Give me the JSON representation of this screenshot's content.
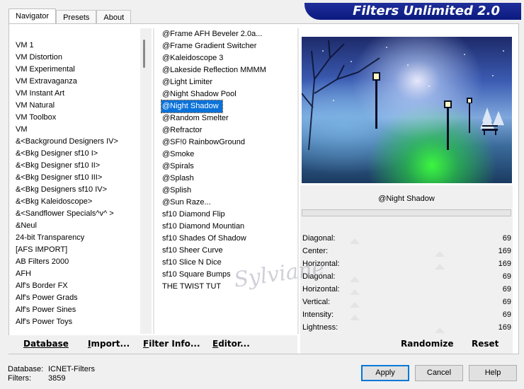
{
  "tabs": [
    {
      "label": "Navigator",
      "active": true
    },
    {
      "label": "Presets",
      "active": false
    },
    {
      "label": "About",
      "active": false
    }
  ],
  "app_title": "Filters Unlimited 2.0",
  "categories": [
    "VM 1",
    "VM Distortion",
    "VM Experimental",
    "VM Extravaganza",
    "VM Instant Art",
    "VM Natural",
    "VM Toolbox",
    "VM",
    "&<Background Designers IV>",
    "&<Bkg Designer sf10 I>",
    "&<Bkg Designer sf10 II>",
    "&<Bkg Designer sf10 III>",
    "&<Bkg Designers sf10 IV>",
    "&<Bkg Kaleidoscope>",
    "&<Sandflower Specials^v^ >",
    "&Neul",
    "24-bit Transparency",
    "[AFS IMPORT]",
    "AB Filters 2000",
    "AFH",
    "Alf's Border FX",
    "Alf's Power Grads",
    "Alf's Power Sines",
    "Alf's Power Toys"
  ],
  "filters": [
    "@Frame AFH Beveler 2.0a...",
    "@Frame Gradient Switcher",
    "@Kaleidoscope 3",
    "@Lakeside Reflection MMMM",
    "@Light Limiter",
    "@Night Shadow Pool",
    "@Night Shadow",
    "@Random Smelter",
    "@Refractor",
    "@SF!0 RainbowGround",
    "@Smoke",
    "@Spirals",
    "@Splash",
    "@Splish",
    "@Sun Raze...",
    "sf10 Diamond Flip",
    "sf10 Diamond Mountian",
    "sf10 Shades Of Shadow",
    "sf10 Sheer Curve",
    "sf10 Slice N Dice",
    "sf10 Square Bumps",
    "THE TWIST TUT"
  ],
  "selected_filter_index": 6,
  "preview_name": "@Night Shadow",
  "params": [
    {
      "label": "Diagonal:",
      "value": "69"
    },
    {
      "label": "Center:",
      "value": "169"
    },
    {
      "label": "Horizontal:",
      "value": "169"
    },
    {
      "label": "Diagonal:",
      "value": "69"
    },
    {
      "label": "Horizontal:",
      "value": "69"
    },
    {
      "label": "Vertical:",
      "value": "69"
    },
    {
      "label": "Intensity:",
      "value": "69"
    },
    {
      "label": "Lightness:",
      "value": "169"
    }
  ],
  "bottom_buttons": {
    "database": {
      "first": "D",
      "rest": "atabase"
    },
    "import": {
      "first": "I",
      "rest": "mport..."
    },
    "filter_info": {
      "first": "F",
      "rest": "ilter Info..."
    },
    "editor": {
      "first": "E",
      "rest": "ditor..."
    },
    "randomize": "Randomize",
    "reset": "Reset"
  },
  "status": {
    "database_label": "Database:",
    "database_value": "ICNET-Filters",
    "filters_label": "Filters:",
    "filters_value": "3859"
  },
  "dialog_buttons": {
    "apply": "Apply",
    "cancel": "Cancel",
    "help": "Help"
  },
  "watermark_text": "Sylviane",
  "colors": {
    "title_banner": "#0b1a80",
    "selection": "#0b72d9"
  }
}
